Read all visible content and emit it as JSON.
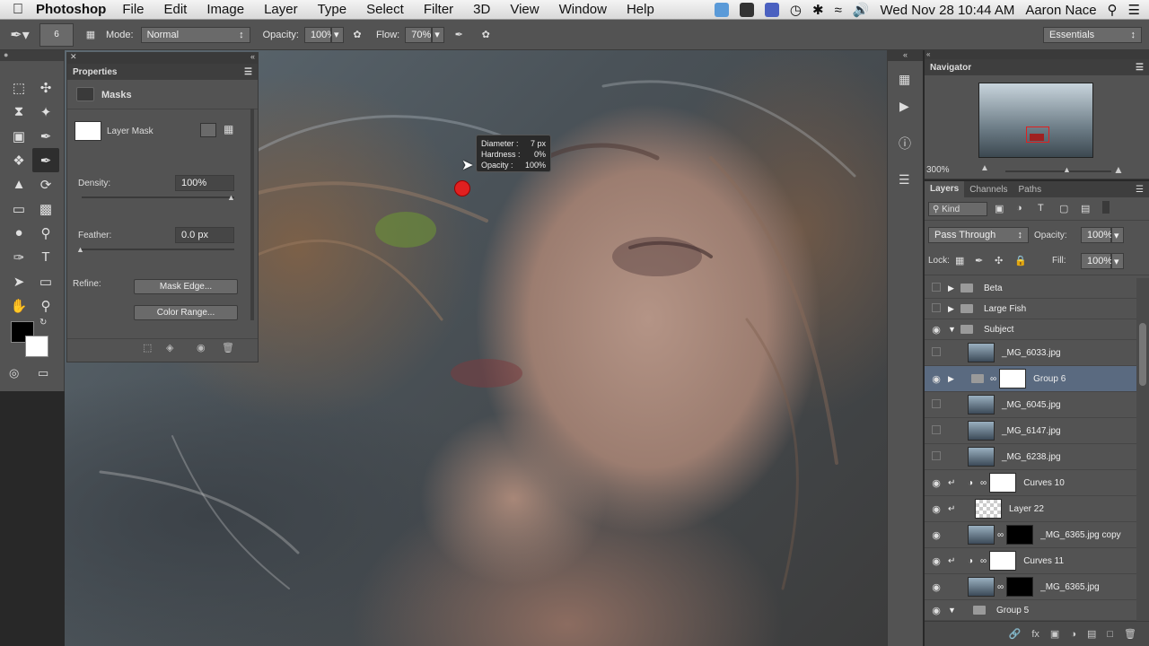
{
  "menubar": {
    "app": "Photoshop",
    "items": [
      "File",
      "Edit",
      "Image",
      "Layer",
      "Type",
      "Select",
      "Filter",
      "3D",
      "View",
      "Window",
      "Help"
    ],
    "clock": "Wed Nov 28  10:44 AM",
    "user": "Aaron Nace"
  },
  "options": {
    "brush_size": "6",
    "mode_label": "Mode:",
    "mode": "Normal",
    "opacity_label": "Opacity:",
    "opacity": "100%",
    "flow_label": "Flow:",
    "flow": "70%",
    "workspace": "Essentials"
  },
  "properties": {
    "tab": "Properties",
    "section": "Masks",
    "mask_label": "Layer Mask",
    "density_label": "Density:",
    "density": "100%",
    "feather_label": "Feather:",
    "feather": "0.0 px",
    "refine_label": "Refine:",
    "mask_edge": "Mask Edge...",
    "color_range": "Color Range..."
  },
  "brush_tip": {
    "diameter_label": "Diameter :",
    "diameter": "7 px",
    "hardness_label": "Hardness :",
    "hardness": "0%",
    "opacity_label": "Opacity :",
    "opacity": "100%"
  },
  "navigator": {
    "title": "Navigator",
    "zoom": "300%"
  },
  "layers_panel": {
    "tabs": [
      "Layers",
      "Channels",
      "Paths"
    ],
    "kind": "Kind",
    "blend": "Pass Through",
    "opacity_label": "Opacity:",
    "opacity": "100%",
    "lock_label": "Lock:",
    "fill_label": "Fill:",
    "fill": "100%"
  },
  "layers": [
    {
      "name": "Beta",
      "type": "group"
    },
    {
      "name": "Large Fish",
      "type": "group"
    },
    {
      "name": "Subject",
      "type": "group-open"
    },
    {
      "name": "_MG_6033.jpg",
      "type": "image"
    },
    {
      "name": "Group 6",
      "type": "group-mask"
    },
    {
      "name": "_MG_6045.jpg",
      "type": "image"
    },
    {
      "name": "_MG_6147.jpg",
      "type": "image"
    },
    {
      "name": "_MG_6238.jpg",
      "type": "image"
    },
    {
      "name": "Curves 10",
      "type": "adjust"
    },
    {
      "name": "Layer 22",
      "type": "transparent"
    },
    {
      "name": "_MG_6365.jpg copy",
      "type": "image-mask"
    },
    {
      "name": "Curves 11",
      "type": "adjust"
    },
    {
      "name": "_MG_6365.jpg",
      "type": "image-mask"
    },
    {
      "name": "Group 5",
      "type": "group-open"
    }
  ],
  "colors": {
    "panel": "#535353",
    "dark": "#3e3e3e",
    "selection": "#5a6a80",
    "brush_dot": "#e02020"
  }
}
